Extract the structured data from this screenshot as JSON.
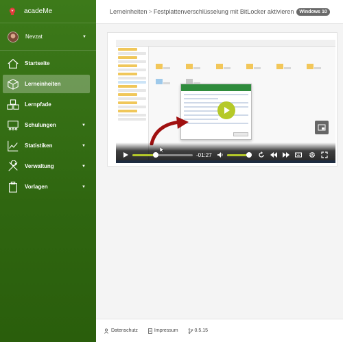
{
  "brand": {
    "name": "acadeMe",
    "accent": "#e03b3b"
  },
  "user": {
    "name": "Nevzat"
  },
  "sidebar": {
    "items": [
      {
        "label": "Startseite",
        "icon": "home-icon",
        "has_submenu": false,
        "active": false
      },
      {
        "label": "Lerneinheiten",
        "icon": "cube-icon",
        "has_submenu": false,
        "active": true
      },
      {
        "label": "Lernpfade",
        "icon": "boxes-icon",
        "has_submenu": false,
        "active": false
      },
      {
        "label": "Schulungen",
        "icon": "training-icon",
        "has_submenu": true,
        "active": false
      },
      {
        "label": "Statistiken",
        "icon": "chart-line-icon",
        "has_submenu": true,
        "active": false
      },
      {
        "label": "Verwaltung",
        "icon": "tools-icon",
        "has_submenu": true,
        "active": false
      },
      {
        "label": "Vorlagen",
        "icon": "clipboard-icon",
        "has_submenu": true,
        "active": false
      }
    ]
  },
  "header": {
    "breadcrumb_root": "Lerneinheiten",
    "separator": ">",
    "page_title": "Festplattenverschlüsselung mit BitLocker aktivieren",
    "badge": "Windows 10"
  },
  "player": {
    "time_remaining": "-01:27",
    "progress": 0.39,
    "volume": 0.9,
    "accent": "#b5c929"
  },
  "footer": {
    "privacy": "Datenschutz",
    "imprint": "Impressum",
    "version": "0.5.15"
  },
  "colors": {
    "sidebar_top": "#3d7a1a",
    "sidebar_bottom": "#2a5e0c"
  }
}
